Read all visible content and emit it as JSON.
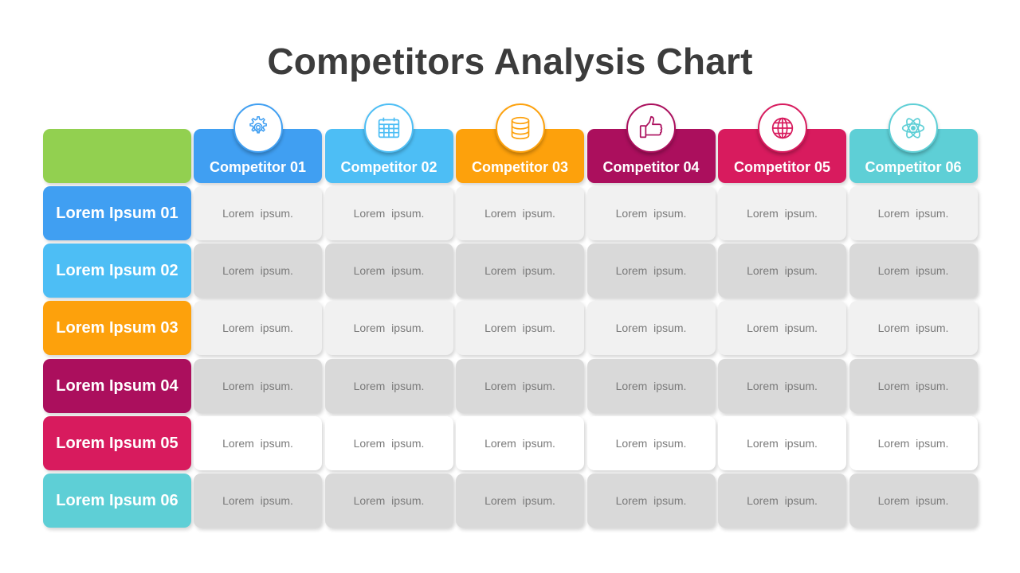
{
  "title": "Competitors Analysis Chart",
  "corner_color": "#92d050",
  "competitors": [
    {
      "label": "Competitor 01",
      "icon": "gear-icon",
      "color": "#409ff2"
    },
    {
      "label": "Competitor 02",
      "icon": "calendar-icon",
      "color": "#4dbef5"
    },
    {
      "label": "Competitor 03",
      "icon": "database-icon",
      "color": "#fda10c"
    },
    {
      "label": "Competitor 04",
      "icon": "thumbs-up-icon",
      "color": "#ab0f5d"
    },
    {
      "label": "Competitor 05",
      "icon": "globe-icon",
      "color": "#d81b5e"
    },
    {
      "label": "Competitor 06",
      "icon": "atom-icon",
      "color": "#5ecfd6"
    }
  ],
  "rows": [
    {
      "label": "Lorem Ipsum 01",
      "color": "#409ff2",
      "cell_bg": "#f1f1f1",
      "cells": [
        "Lorem  ipsum.",
        "Lorem  ipsum.",
        "Lorem  ipsum.",
        "Lorem  ipsum.",
        "Lorem  ipsum.",
        "Lorem  ipsum."
      ]
    },
    {
      "label": "Lorem Ipsum 02",
      "color": "#4dbef5",
      "cell_bg": "#d9d9d9",
      "cells": [
        "Lorem  ipsum.",
        "Lorem  ipsum.",
        "Lorem  ipsum.",
        "Lorem  ipsum.",
        "Lorem  ipsum.",
        "Lorem  ipsum."
      ]
    },
    {
      "label": "Lorem Ipsum 03",
      "color": "#fda10c",
      "cell_bg": "#f1f1f1",
      "cells": [
        "Lorem  ipsum.",
        "Lorem  ipsum.",
        "Lorem  ipsum.",
        "Lorem  ipsum.",
        "Lorem  ipsum.",
        "Lorem  ipsum."
      ]
    },
    {
      "label": "Lorem Ipsum 04",
      "color": "#ab0f5d",
      "cell_bg": "#d9d9d9",
      "cells": [
        "Lorem  ipsum.",
        "Lorem  ipsum.",
        "Lorem  ipsum.",
        "Lorem  ipsum.",
        "Lorem  ipsum.",
        "Lorem  ipsum."
      ]
    },
    {
      "label": "Lorem Ipsum 05",
      "color": "#d81b5e",
      "cell_bg": "#ffffff",
      "cells": [
        "Lorem  ipsum.",
        "Lorem  ipsum.",
        "Lorem  ipsum.",
        "Lorem  ipsum.",
        "Lorem  ipsum.",
        "Lorem  ipsum."
      ]
    },
    {
      "label": "Lorem Ipsum 06",
      "color": "#5ecfd6",
      "cell_bg": "#d9d9d9",
      "cells": [
        "Lorem  ipsum.",
        "Lorem  ipsum.",
        "Lorem  ipsum.",
        "Lorem  ipsum.",
        "Lorem  ipsum.",
        "Lorem  ipsum."
      ]
    }
  ]
}
